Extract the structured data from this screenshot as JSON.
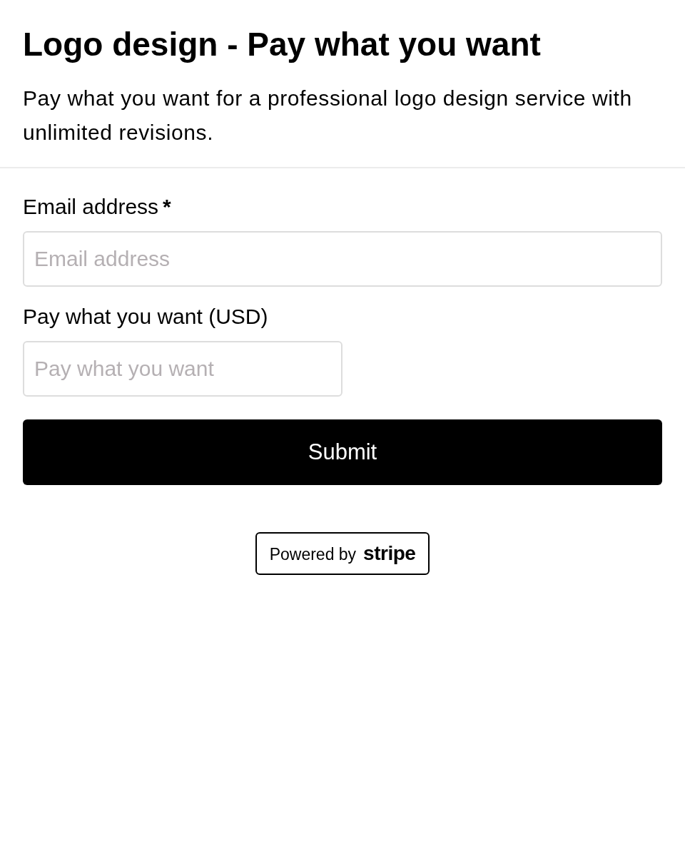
{
  "header": {
    "title": "Logo design - Pay what you want",
    "description": "Pay what you want for a professional logo design service with unlimited revisions."
  },
  "fields": [
    {
      "label": "Email address",
      "required_mark": "*",
      "placeholder": "Email address",
      "kind": "email"
    },
    {
      "label": "Pay what you want (USD)",
      "placeholder": "Pay what you want",
      "kind": "amount"
    }
  ],
  "submit": "Submit",
  "badge": {
    "prefix": "Powered by",
    "brand": "stripe"
  }
}
